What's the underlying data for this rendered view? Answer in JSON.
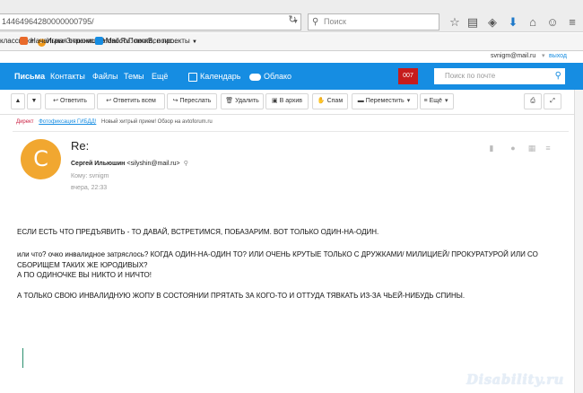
{
  "browser": {
    "url": "14464964280000000795/",
    "search_placeholder": "Поиск",
    "bookmarks": [
      {
        "label": "классники",
        "count": "2"
      },
      {
        "label": "Игры"
      },
      {
        "label": "Знакомства"
      },
      {
        "label": "Новости"
      },
      {
        "label": "Поиск"
      },
      {
        "label": "Все проекты"
      }
    ],
    "bookmark_tabs": [
      {
        "label": "Начальная страница"
      },
      {
        "label": "Mail.Ru: почта, поис..."
      }
    ],
    "user": "svnigm@mail.ru",
    "logout": "выход"
  },
  "mail_nav": {
    "items": [
      "Письма",
      "Контакты",
      "Файлы",
      "Темы",
      "Ещё"
    ],
    "calendar": "Календарь",
    "cloud": "Облако",
    "badge": "007",
    "search_placeholder": "Поиск по почте"
  },
  "toolbar": {
    "reply": "Ответить",
    "reply_all": "Ответить всем",
    "forward": "Переслать",
    "delete": "Удалить",
    "archive": "В архив",
    "spam": "Спам",
    "move": "Переместить",
    "more": "Ещё"
  },
  "ad": {
    "label": "Директ",
    "title": "Фотофиксация ГИБДД!",
    "text": "Новый хитрый прием! Обзор на avtoforum.ru"
  },
  "message": {
    "avatar_letter": "С",
    "subject": "Re:",
    "from_name": "Сергей Ильюшин",
    "from_email": "<silyshin@mail.ru>",
    "to": "Кому: svnigm",
    "time": "вчера, 22:33",
    "body": [
      "ЕСЛИ ЕСТЬ ЧТО ПРЕДЪЯВИТЬ - ТО ДАВАЙ, ВСТРЕТИМСЯ, ПОБАЗАРИМ. ВОТ ТОЛЬКО ОДИН-НА-ОДИН.",
      "или что? очко инвалидное затряслось? КОГДА ОДИН-НА-ОДИН ТО? ИЛИ ОЧЕНЬ КРУТЫЕ ТОЛЬКО С ДРУЖКАМИ/ МИЛИЦИЕЙ/ ПРОКУРАТУРОЙ ИЛИ СО",
      "СБОРИЩЕМ ТАКИХ ЖЕ ЮРОДИВЫХ?",
      "А ПО ОДИНОЧКЕ ВЫ НИКТО И НИЧТО!",
      "А ТОЛЬКО СВОЮ ИНВАЛИДНУЮ ЖОПУ В СОСТОЯНИИ ПРЯТАТЬ ЗА КОГО-ТО И ОТТУДА ТЯВКАТЬ ИЗ-ЗА ЧЬЕЙ-НИБУДЬ СПИНЫ."
    ]
  },
  "watermark": "Disability.ru",
  "colors": {
    "brand_blue": "#168de2",
    "badge_red": "#c61c1c",
    "avatar_orange": "#f1a730"
  }
}
